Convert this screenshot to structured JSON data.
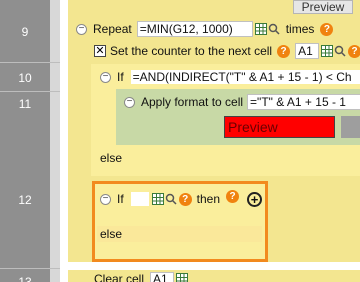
{
  "colors": {
    "highlight": "#f28a1e",
    "preview_bg": "#ff0000",
    "help": "#f0820f",
    "gutter": "#8f8f8f"
  },
  "line_numbers": [
    "9",
    "10",
    "11",
    "12",
    "13"
  ],
  "top_preview": {
    "label": "Preview"
  },
  "repeat": {
    "keyword": "Repeat",
    "expr": "=MIN(G12, 1000)",
    "suffix": "times"
  },
  "counter": {
    "checked": true,
    "label": "Set the counter to the next cell",
    "cell": "A1"
  },
  "if1": {
    "keyword": "If",
    "expr": "=AND(INDIRECT(\"T\" & A1 + 15 - 1) < Ch"
  },
  "apply_format": {
    "label": "Apply format to cell",
    "expr": "=\"T\" & A1 + 15 - 1",
    "preview": "Preview"
  },
  "else1": "else",
  "if2": {
    "keyword": "If",
    "then": "then"
  },
  "else2": "else",
  "clear_cell": {
    "label": "Clear cell",
    "cell": "A1"
  }
}
